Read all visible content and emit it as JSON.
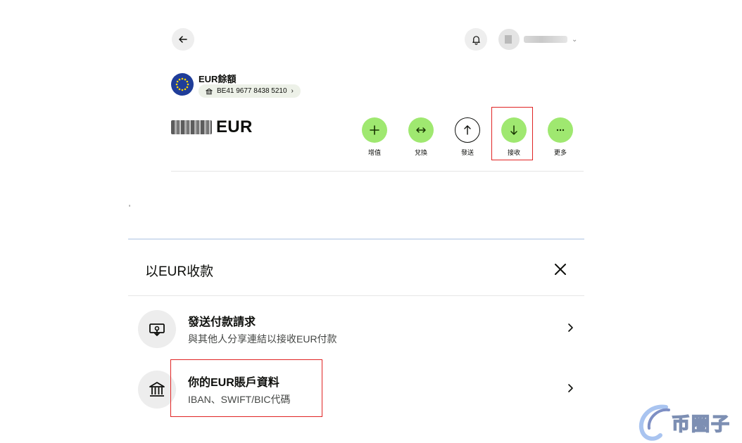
{
  "account": {
    "title": "EUR餘額",
    "iban": "BE41 9677 8438 5210",
    "currency": "EUR"
  },
  "actions": [
    {
      "label": "增值",
      "icon": "plus-icon"
    },
    {
      "label": "兌換",
      "icon": "swap-icon"
    },
    {
      "label": "發送",
      "icon": "arrow-up-icon"
    },
    {
      "label": "接收",
      "icon": "arrow-down-icon"
    },
    {
      "label": "更多",
      "icon": "more-icon"
    }
  ],
  "stray_mark": "'",
  "sheet": {
    "title": "以EUR收款",
    "options": [
      {
        "title": "發送付款請求",
        "subtitle": "與其他人分享連結以接收EUR付款",
        "icon": "payment-request-icon"
      },
      {
        "title": "你的EUR賬戶資料",
        "subtitle": "IBAN、SWIFT/BIC代碼",
        "icon": "bank-icon"
      }
    ]
  },
  "watermark": {
    "text": "币圈子"
  },
  "colors": {
    "accent_green": "#9fe870",
    "highlight_red": "#e02424",
    "eu_blue": "#1f3d99"
  }
}
